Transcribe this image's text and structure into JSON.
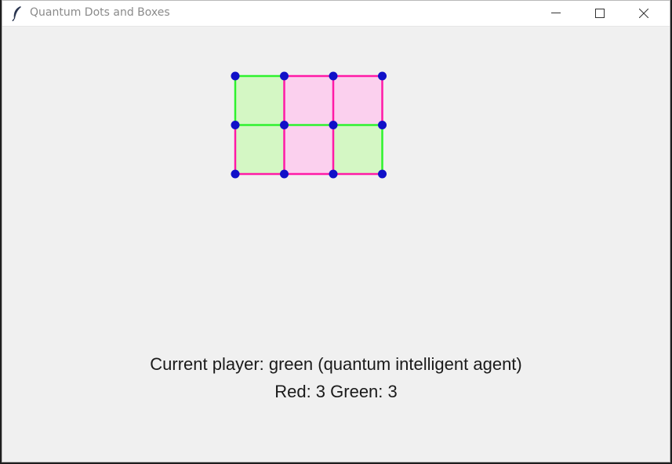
{
  "window": {
    "title": "Quantum Dots and Boxes",
    "app_icon": "feather-icon"
  },
  "titlebar_buttons": [
    {
      "name": "minimize",
      "icon": "minimize-icon"
    },
    {
      "name": "maximize",
      "icon": "maximize-icon"
    },
    {
      "name": "close",
      "icon": "close-icon"
    }
  ],
  "colors": {
    "green_line": "#2ef22e",
    "red_line": "#ff1aa6",
    "green_box_fill": "#d4f7c4",
    "red_box_fill": "#fbd0ee",
    "dot": "#1010c8"
  },
  "board": {
    "dot_rows": 3,
    "dot_cols": 4,
    "horizontal_edges": [
      [
        "green",
        "red",
        "red"
      ],
      [
        "green",
        "green",
        "green"
      ],
      [
        "red",
        "red",
        "red"
      ]
    ],
    "vertical_edges": [
      [
        "green",
        "red",
        "red",
        "red"
      ],
      [
        "red",
        "red",
        "red",
        "green"
      ]
    ],
    "boxes": [
      [
        "green",
        "red",
        "red"
      ],
      [
        "green",
        "red",
        "green"
      ]
    ]
  },
  "status": {
    "current_player_text": "Current player: green (quantum intelligent agent)",
    "score_text": "Red: 3 Green: 3"
  },
  "score": {
    "red": 3,
    "green": 3
  }
}
